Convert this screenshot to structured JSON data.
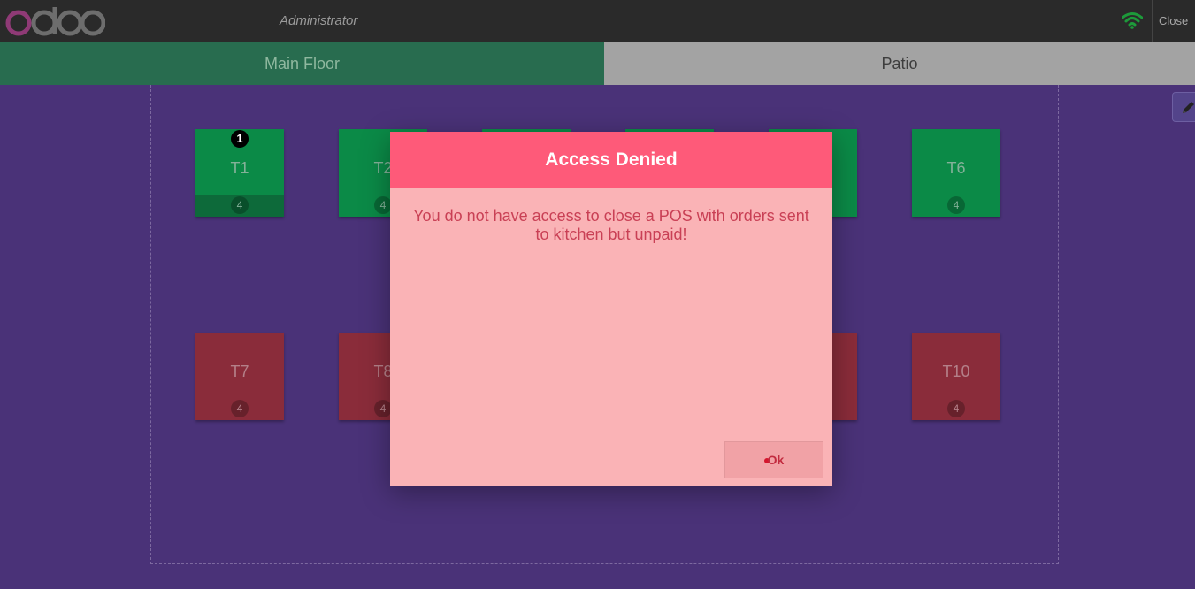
{
  "header": {
    "username": "Administrator",
    "close_label": "Close"
  },
  "tabs": [
    {
      "label": "Main Floor",
      "active": true
    },
    {
      "label": "Patio",
      "active": false
    }
  ],
  "tables": [
    {
      "name": "T1",
      "seats": "4",
      "status": "green",
      "orders": "1"
    },
    {
      "name": "T2",
      "seats": "4",
      "status": "green"
    },
    {
      "name": "T6",
      "seats": "4",
      "status": "green"
    },
    {
      "name": "T7",
      "seats": "4",
      "status": "red"
    },
    {
      "name": "T8",
      "seats": "4",
      "status": "red"
    },
    {
      "name": "T10",
      "seats": "4",
      "status": "red"
    }
  ],
  "modal": {
    "title": "Access Denied",
    "message": "You do not have access to close a POS with orders sent to kitchen but unpaid!",
    "ok_label": "Ok"
  },
  "colors": {
    "background": "#4a3278",
    "table_green": "#0b8a47",
    "table_red": "#8a2c3a",
    "modal_header": "#fe5a79",
    "modal_body": "#fab3b6"
  }
}
